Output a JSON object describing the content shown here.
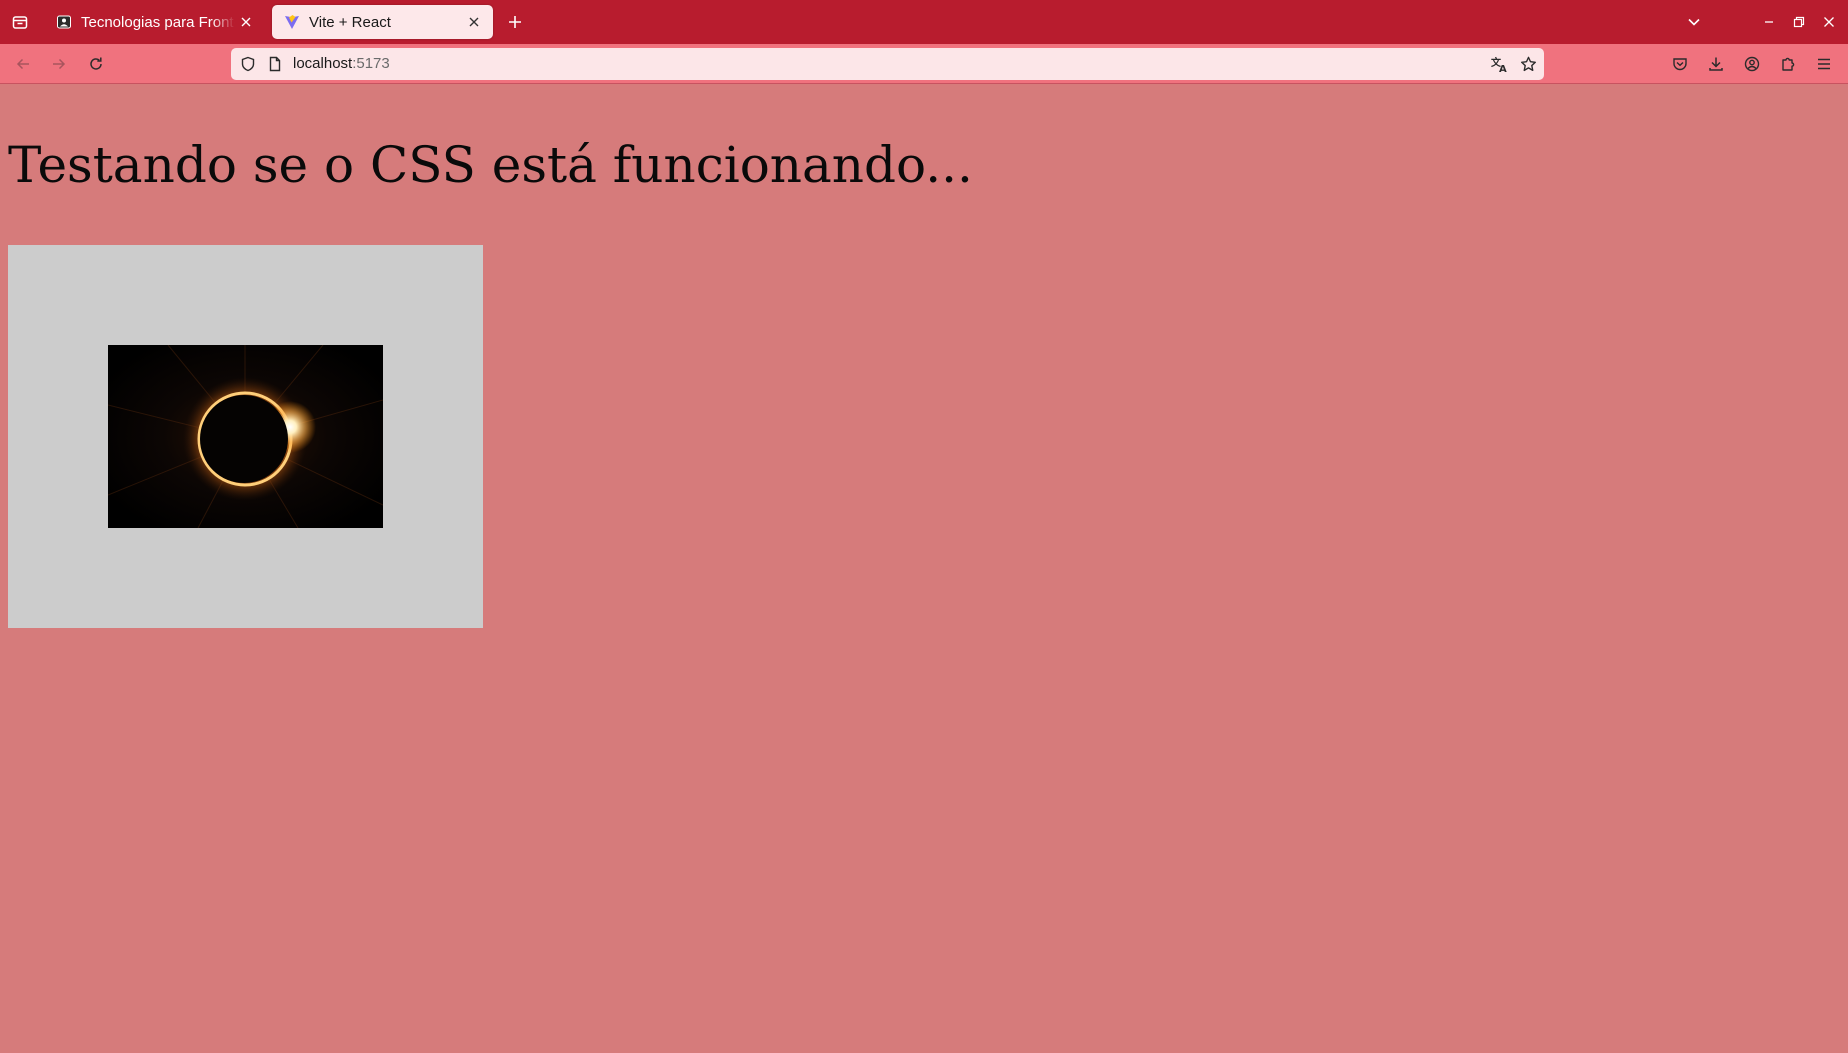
{
  "browser": {
    "tabs": [
      {
        "label": "Tecnologias para Front-end",
        "active": false
      },
      {
        "label": "Vite + React",
        "active": true
      }
    ],
    "address_bar": {
      "host": "localhost",
      "port": ":5173"
    }
  },
  "page": {
    "heading": "Testando se o CSS está funcionando...",
    "image_alt": "eclipse"
  },
  "colors": {
    "tabstrip": "#b81c2e",
    "toolbar": "#f0727e",
    "urlbar": "#fce6e8",
    "page_background": "#d67b7b",
    "image_box_background": "#cccccc"
  },
  "icons": [
    "tab-list-icon",
    "close-icon",
    "plus-icon",
    "chevron-down-icon",
    "minimize-icon",
    "restore-icon",
    "back-arrow-icon",
    "forward-arrow-icon",
    "reload-icon",
    "shield-icon",
    "page-icon",
    "translate-icon",
    "star-icon",
    "pocket-icon",
    "download-icon",
    "account-icon",
    "extensions-icon",
    "menu-icon"
  ]
}
